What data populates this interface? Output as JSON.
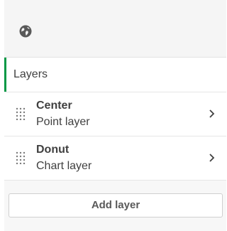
{
  "header": {
    "icon": "globe-icon"
  },
  "section": {
    "title": "Layers",
    "accent_color": "#009845"
  },
  "layers": [
    {
      "name": "Center",
      "type": "Point layer",
      "icon": "drag-handle-icon"
    },
    {
      "name": "Donut",
      "type": "Chart layer",
      "icon": "drag-handle-icon"
    }
  ],
  "actions": {
    "add_layer": "Add layer"
  }
}
